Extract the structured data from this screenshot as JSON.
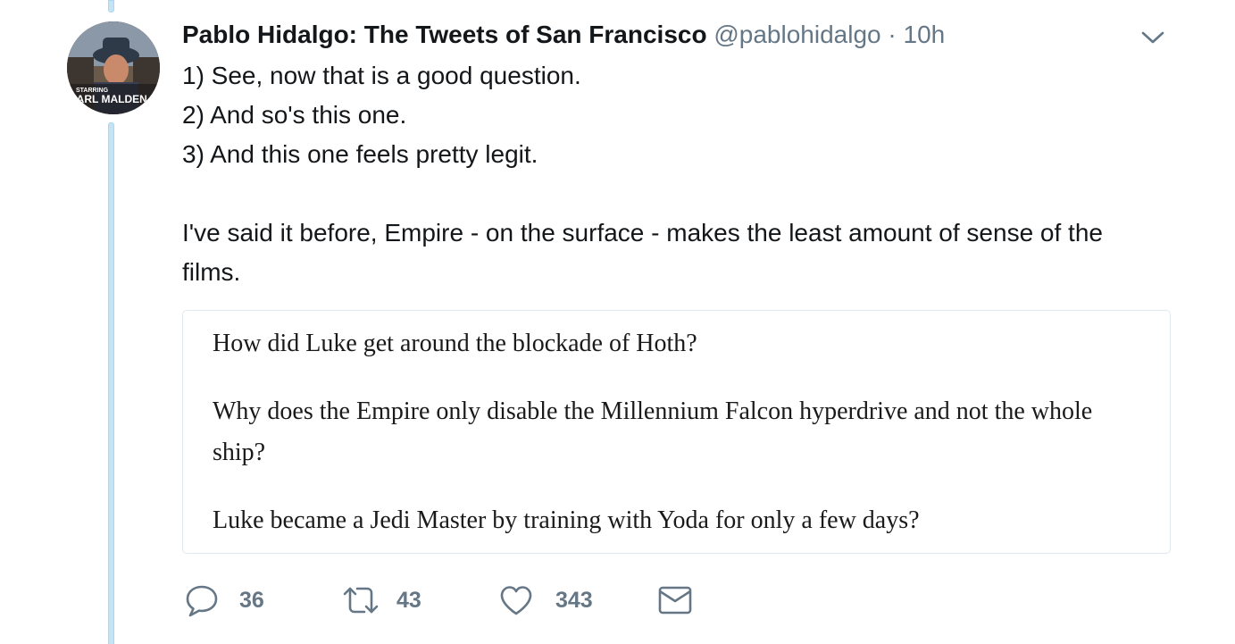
{
  "tweet": {
    "display_name": "Pablo Hidalgo: The Tweets of San Francisco",
    "handle": "@pablohidalgo",
    "separator": "·",
    "timestamp": "10h",
    "text_lines": [
      "1) See, now that is a good question.",
      "2) And so's this one.",
      "3) And this one feels pretty legit."
    ],
    "text_paragraph": "I've said it before, Empire - on the surface - makes the least amount of sense of the films.",
    "avatar": {
      "caption_small": "STARRING",
      "caption_large": "KARL MALDEN"
    }
  },
  "quote_image": {
    "lines": [
      "How did Luke get around the blockade of Hoth?",
      "Why does the Empire only disable the Millennium Falcon hyperdrive and not the whole ship?",
      "Luke became a Jedi Master by training with Yoda for only a few days?"
    ]
  },
  "actions": {
    "reply_count": "36",
    "retweet_count": "43",
    "like_count": "343"
  },
  "icons": {
    "reply": "reply-icon",
    "retweet": "retweet-icon",
    "like": "heart-icon",
    "message": "envelope-icon",
    "menu": "chevron-down-icon"
  },
  "colors": {
    "text": "#14171a",
    "secondary": "#657786",
    "thread_line": "#c4e3f6",
    "card_border": "#e1e8ed"
  }
}
